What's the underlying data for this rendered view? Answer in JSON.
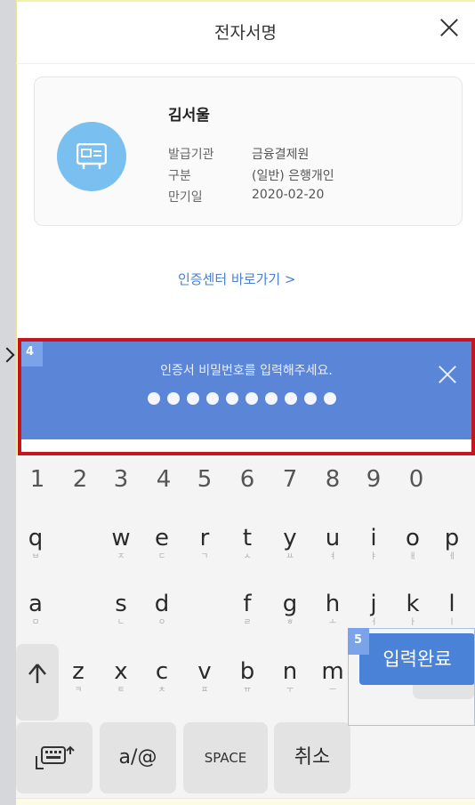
{
  "header": {
    "title": "전자서명"
  },
  "certificate": {
    "name": "김서울",
    "rows": [
      {
        "label": "발급기관",
        "value": "금융결제원"
      },
      {
        "label": "구분",
        "value": "(일반) 은행개인"
      },
      {
        "label": "만기일",
        "value": "2020-02-20"
      }
    ],
    "icon": "certificate-icon"
  },
  "links": {
    "cert_center": "인증센터 바로가기 >"
  },
  "password": {
    "label": "인증서 비밀번호를 입력해주세요.",
    "dot_count": 10
  },
  "annotations": {
    "badge_4": "4",
    "badge_5": "5"
  },
  "keyboard": {
    "numbers": [
      "1",
      "2",
      "3",
      "4",
      "5",
      "6",
      "7",
      "8",
      "9",
      "0"
    ],
    "row1": [
      {
        "main": "q",
        "sub": "ㅂ"
      },
      {
        "main": "",
        "sub": ""
      },
      {
        "main": "w",
        "sub": "ㅈ"
      },
      {
        "main": "e",
        "sub": "ㄷ"
      },
      {
        "main": "r",
        "sub": "ㄱ"
      },
      {
        "main": "t",
        "sub": "ㅅ"
      },
      {
        "main": "y",
        "sub": "ㅛ"
      },
      {
        "main": "u",
        "sub": "ㅕ"
      },
      {
        "main": "i",
        "sub": "ㅑ"
      },
      {
        "main": "o",
        "sub": "ㅐ"
      },
      {
        "main": "p",
        "sub": "ㅔ"
      }
    ],
    "row2": [
      {
        "main": "a",
        "sub": "ㅁ"
      },
      {
        "main": "",
        "sub": ""
      },
      {
        "main": "s",
        "sub": "ㄴ"
      },
      {
        "main": "d",
        "sub": "ㅇ"
      },
      {
        "main": "",
        "sub": ""
      },
      {
        "main": "f",
        "sub": "ㄹ"
      },
      {
        "main": "g",
        "sub": "ㅎ"
      },
      {
        "main": "h",
        "sub": "ㅗ"
      },
      {
        "main": "j",
        "sub": "ㅓ"
      },
      {
        "main": "k",
        "sub": "ㅏ"
      },
      {
        "main": "l",
        "sub": "ㅣ"
      }
    ],
    "row3": [
      {
        "main": "z",
        "sub": "ㅋ"
      },
      {
        "main": "x",
        "sub": "ㅌ"
      },
      {
        "main": "c",
        "sub": "ㅊ"
      },
      {
        "main": "v",
        "sub": "ㅍ"
      },
      {
        "main": "b",
        "sub": "ㅠ"
      },
      {
        "main": "n",
        "sub": "ㅜ"
      },
      {
        "main": "m",
        "sub": "ㅡ"
      }
    ],
    "shift_icon": "shift-arrow-icon",
    "backspace_icon": "backspace-icon",
    "lang_icon": "keyboard-switch-icon",
    "symbol_key": "a/@",
    "space_key": "SPACE",
    "cancel_key": "취소",
    "submit_key": "입력완료"
  }
}
